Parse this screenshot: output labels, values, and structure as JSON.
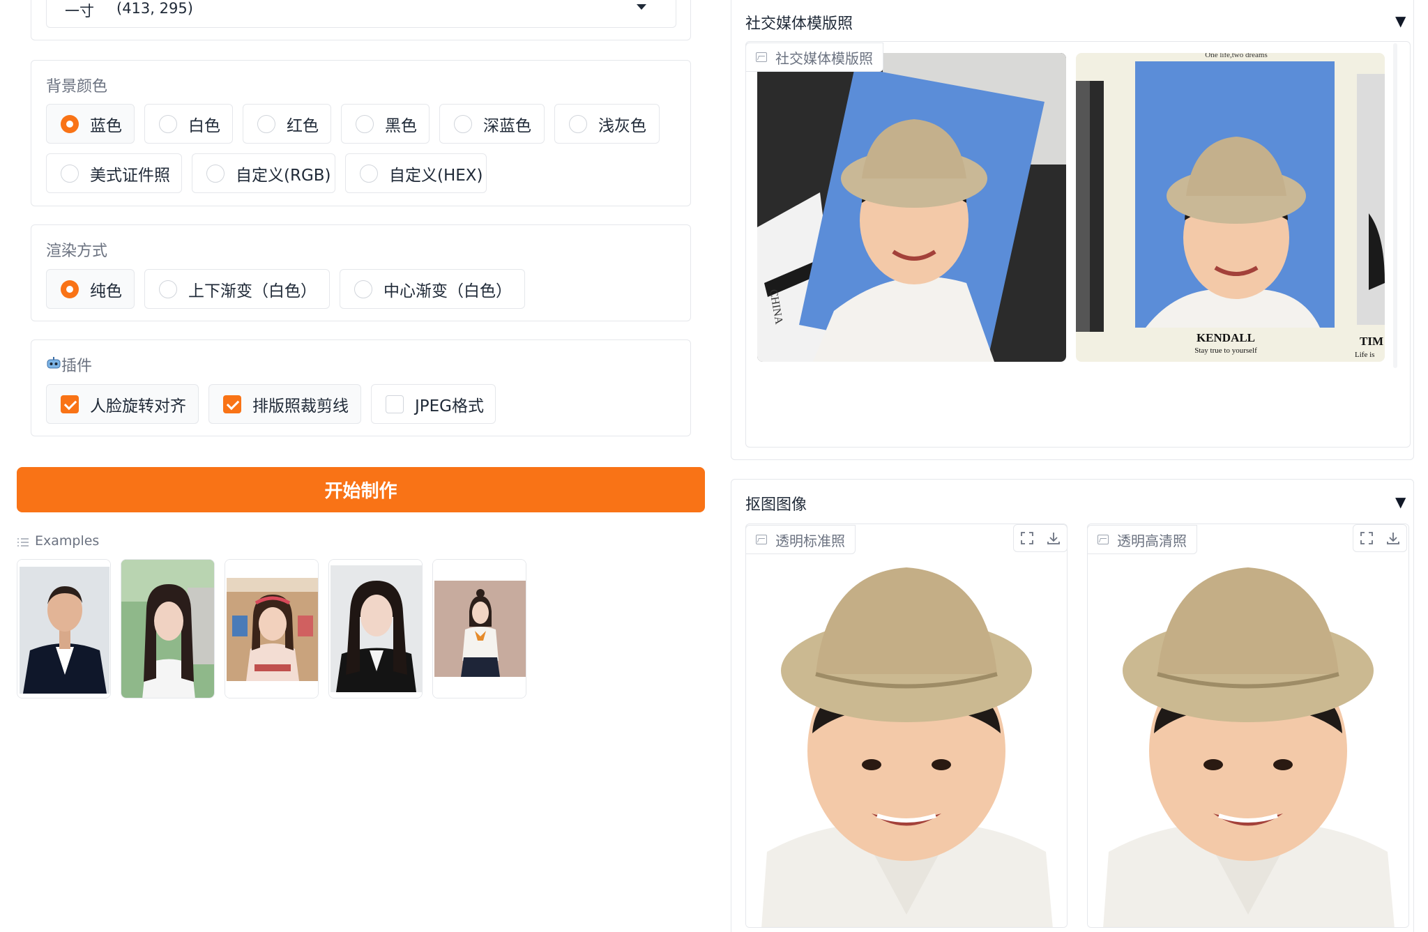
{
  "size_select": {
    "value": "一寸",
    "dims": "(413, 295)"
  },
  "background_color": {
    "label": "背景颜色",
    "options": [
      "蓝色",
      "白色",
      "红色",
      "黑色",
      "深蓝色",
      "浅灰色",
      "美式证件照",
      "自定义(RGB)",
      "自定义(HEX)"
    ],
    "selected": "蓝色"
  },
  "render_mode": {
    "label": "渲染方式",
    "options": [
      "纯色",
      "上下渐变（白色）",
      "中心渐变（白色）"
    ],
    "selected": "纯色"
  },
  "plugins": {
    "label": "插件",
    "options": [
      "人脸旋转对齐",
      "排版照裁剪线",
      "JPEG格式"
    ],
    "checked": [
      true,
      true,
      false
    ]
  },
  "start_button": {
    "label": "开始制作"
  },
  "examples": {
    "label": "Examples"
  },
  "social_template": {
    "title": "社交媒体模版照",
    "tag": "社交媒体模版照",
    "card_top_text": "One life,two dreams",
    "card_name": "KENDALL",
    "card_subtitle": "Stay true to yourself",
    "card_side_name": "TIM",
    "card_side_sub": "Life is",
    "postcard_text": "CHINA"
  },
  "matting": {
    "title": "抠图图像",
    "image1_tag": "透明标准照",
    "image2_tag": "透明高清照"
  },
  "colors": {
    "accent": "#f97316",
    "photo_blue": "#5b8dd8",
    "border": "#e5e7eb"
  },
  "icons": [
    "image-icon",
    "fullscreen-icon",
    "download-icon",
    "list-icon",
    "chevron-down-icon",
    "robot-icon"
  ]
}
